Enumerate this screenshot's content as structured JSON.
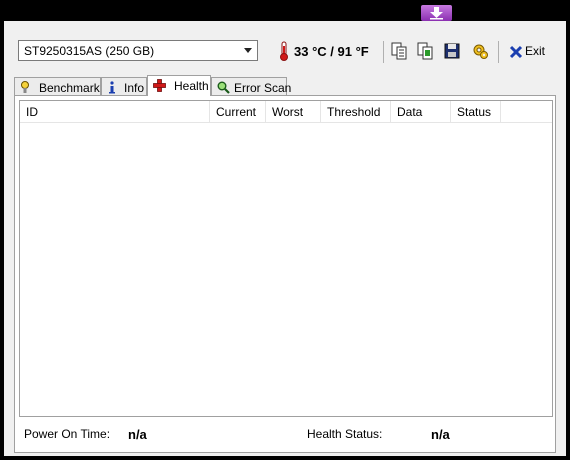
{
  "drive": {
    "selected": "ST9250315AS (250 GB)"
  },
  "temperature": {
    "text": "33 °C / 91 °F"
  },
  "toolbar": {
    "exit_label": "Exit"
  },
  "tabs": [
    {
      "label": "Benchmark"
    },
    {
      "label": "Info"
    },
    {
      "label": "Health"
    },
    {
      "label": "Error Scan"
    }
  ],
  "active_tab": "Health",
  "table": {
    "columns": [
      "ID",
      "Current",
      "Worst",
      "Threshold",
      "Data",
      "Status"
    ],
    "rows": []
  },
  "footer": {
    "power_on_label": "Power On Time:",
    "power_on_value": "n/a",
    "health_label": "Health Status:",
    "health_value": "n/a"
  },
  "colors": {
    "accent_download": "#a64fd0",
    "thermometer": "#d01818"
  }
}
